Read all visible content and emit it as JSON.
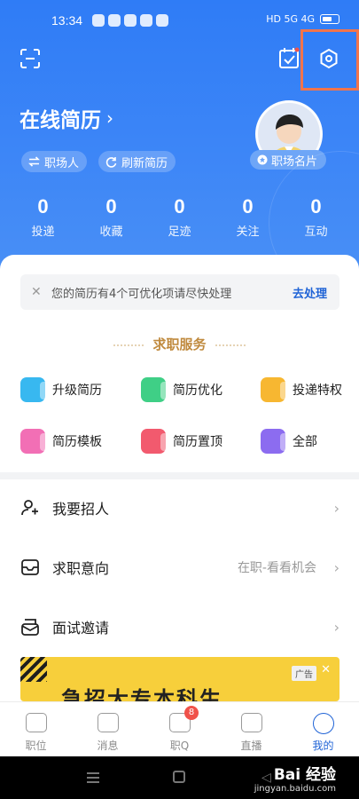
{
  "status_bar": {
    "time": "13:34",
    "right_icons": "HD 5G 4G"
  },
  "header": {
    "resume_title": "在线简历",
    "resume_chevron": "›",
    "role_pill": "职场人",
    "refresh_pill": "刷新简历",
    "card_pill": "职场名片"
  },
  "stats": [
    {
      "value": "0",
      "label": "投递"
    },
    {
      "value": "0",
      "label": "收藏"
    },
    {
      "value": "0",
      "label": "足迹"
    },
    {
      "value": "0",
      "label": "关注"
    },
    {
      "value": "0",
      "label": "互动"
    }
  ],
  "notice": {
    "close": "✕",
    "message": "您的简历有4个可优化项请尽快处理",
    "action": "去处理"
  },
  "services": {
    "title": "求职服务",
    "items": [
      {
        "label": "升级简历",
        "icon": "upgrade-resume-icon",
        "color": "#38b8f0"
      },
      {
        "label": "简历优化",
        "icon": "resume-optimize-icon",
        "color": "#3fcf86"
      },
      {
        "label": "投递特权",
        "icon": "delivery-privilege-icon",
        "color": "#f7b731"
      },
      {
        "label": "简历模板",
        "icon": "resume-template-icon",
        "color": "#f26fb5"
      },
      {
        "label": "简历置顶",
        "icon": "resume-pin-icon",
        "color": "#f25a6e"
      },
      {
        "label": "全部",
        "icon": "all-services-icon",
        "color": "#8c6cf0"
      }
    ]
  },
  "list": [
    {
      "label": "我要招人",
      "value": "",
      "icon": "recruit-icon"
    },
    {
      "label": "求职意向",
      "value": "在职-看看机会",
      "icon": "job-intention-icon"
    },
    {
      "label": "面试邀请",
      "value": "",
      "icon": "interview-invite-icon"
    }
  ],
  "ad": {
    "tag": "广告",
    "close": "✕",
    "text": "急招大专本科生"
  },
  "tabbar": [
    {
      "label": "职位",
      "icon": "briefcase-icon",
      "badge": ""
    },
    {
      "label": "消息",
      "icon": "message-icon",
      "badge": ""
    },
    {
      "label": "职Q",
      "icon": "job-q-icon",
      "badge": "8"
    },
    {
      "label": "直播",
      "icon": "live-icon",
      "badge": ""
    },
    {
      "label": "我的",
      "icon": "profile-icon",
      "badge": ""
    }
  ],
  "watermark": {
    "brand": "Bai 经验",
    "url": "jingyan.baidu.com"
  },
  "colors": {
    "primary": "#2f7cf6",
    "accent": "#1f63d6",
    "highlight_border": "#f2744b",
    "ad_bg": "#f7cf3b"
  }
}
